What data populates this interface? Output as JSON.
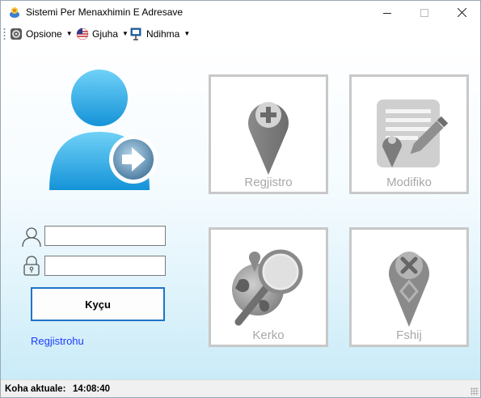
{
  "window": {
    "title": "Sistemi Per Menaxhimin E Adresave"
  },
  "menu": {
    "items": [
      {
        "label": "Opsione",
        "icon": "settings-icon"
      },
      {
        "label": "Gjuha",
        "icon": "flag-icon"
      },
      {
        "label": "Ndihma",
        "icon": "help-icon"
      }
    ]
  },
  "login": {
    "username_value": "",
    "password_value": "",
    "login_label": "Kyçu",
    "register_label": "Regjistrohu"
  },
  "tiles": {
    "regjistro": "Regjistro",
    "modifiko": "Modifiko",
    "kerko": "Kerko",
    "fshij": "Fshij"
  },
  "status": {
    "label": "Koha aktuale:",
    "time": "14:08:40"
  },
  "colors": {
    "accent_blue": "#1f74c8",
    "user_icon_blue": "#29a8e6",
    "link_blue": "#1a3cff",
    "tile_gray": "#a8a8a8"
  }
}
